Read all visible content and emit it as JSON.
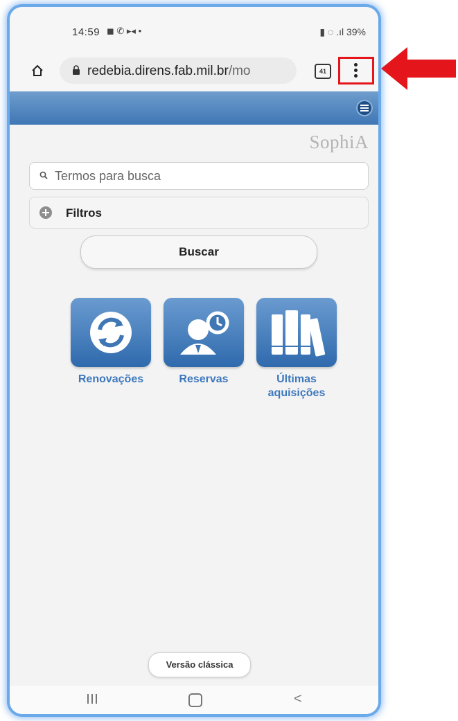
{
  "status": {
    "time": "14:59",
    "icons": "◼ ✆ ▸◂ •",
    "battery": "39%"
  },
  "browser": {
    "url_main": "redebia.direns.fab.mil.br",
    "url_rest": "/mo",
    "tab_count": "41"
  },
  "app": {
    "logo": "SophiA",
    "search_placeholder": "Termos para busca",
    "filters_label": "Filtros",
    "search_button": "Buscar",
    "tiles": [
      {
        "label": "Renovações",
        "icon": "refresh-icon"
      },
      {
        "label": "Reservas",
        "icon": "person-clock-icon"
      },
      {
        "label_line1": "Últimas",
        "label_line2": "aquisições",
        "icon": "books-icon"
      }
    ],
    "classic_version": "Versão clássica"
  },
  "colors": {
    "accent": "#3f76b4",
    "annotation": "#e4161c"
  }
}
